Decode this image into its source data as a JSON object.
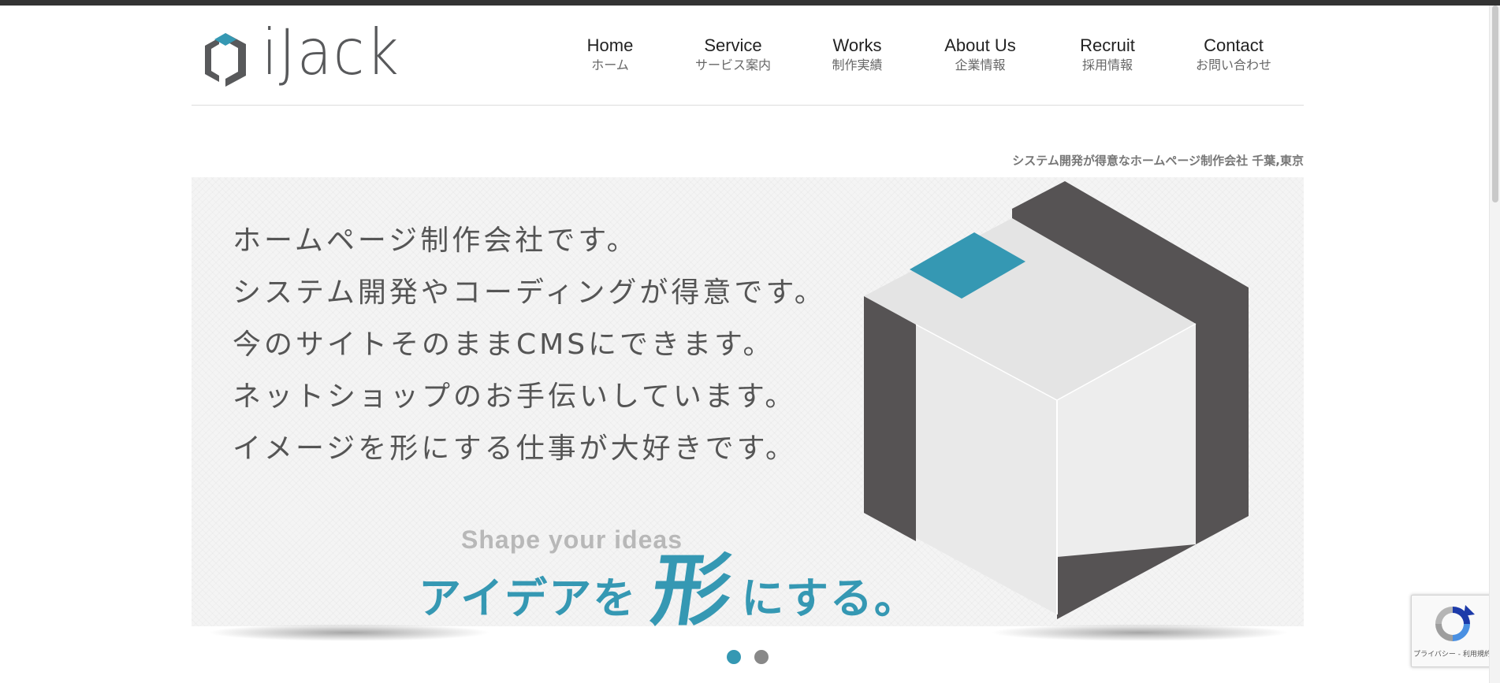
{
  "header": {
    "logo_text": "iJack",
    "nav": [
      {
        "en": "Home",
        "ja": "ホーム"
      },
      {
        "en": "Service",
        "ja": "サービス案内"
      },
      {
        "en": "Works",
        "ja": "制作実績"
      },
      {
        "en": "About Us",
        "ja": "企業情報"
      },
      {
        "en": "Recruit",
        "ja": "採用情報"
      },
      {
        "en": "Contact",
        "ja": "お問い合わせ"
      }
    ]
  },
  "tagline": "システム開発が得意なホームページ制作会社 千葉,東京",
  "hero": {
    "lines": [
      "ホームページ制作会社です。",
      "システム開発やコーディングが得意です。",
      "今のサイトそのままCMSにできます。",
      "ネットショップのお手伝いしています。",
      "イメージを形にする仕事が大好きです。"
    ],
    "slogan_en": "Shape your ideas",
    "slogan_part1": "アイデアを",
    "slogan_kanji": "形",
    "slogan_part2": "にする。"
  },
  "slider": {
    "active_index": 1,
    "total": 2
  },
  "recaptcha": {
    "links": "プライバシー - 利用規約"
  },
  "colors": {
    "accent": "#3598b3",
    "dark": "#58595b",
    "topbar": "#333333"
  }
}
